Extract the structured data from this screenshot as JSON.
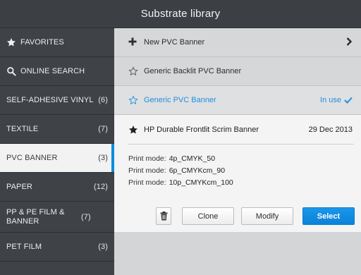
{
  "header": {
    "title": "Substrate library"
  },
  "sidebar": {
    "items": [
      {
        "label": "FAVORITES",
        "icon": "star-icon"
      },
      {
        "label": "ONLINE SEARCH",
        "icon": "search-icon"
      },
      {
        "label": "SELF-ADHESIVE VINYL",
        "count": "(6)"
      },
      {
        "label": "TEXTILE",
        "count": "(7)"
      },
      {
        "label": "PVC BANNER",
        "count": "(3)",
        "selected": true
      },
      {
        "label": "PAPER",
        "count": "(12)"
      },
      {
        "label": "PP & PE FILM & BANNER",
        "count": "(7)"
      },
      {
        "label": "PET FILM",
        "count": "(3)"
      }
    ]
  },
  "main": {
    "new_item": {
      "label": "New PVC Banner"
    },
    "items": [
      {
        "label": "Generic Backlit PVC Banner"
      },
      {
        "label": "Generic PVC Banner",
        "status": "In use"
      }
    ],
    "expanded": {
      "name": "HP Durable Frontlit Scrim Banner",
      "date": "29 Dec 2013",
      "print_modes": [
        {
          "label": "Print mode:",
          "value": "4p_CMYK_50"
        },
        {
          "label": "Print mode:",
          "value": "6p_CMYKcm_90"
        },
        {
          "label": "Print mode:",
          "value": "10p_CMYKcm_100"
        }
      ],
      "actions": {
        "clone": "Clone",
        "modify": "Modify",
        "select": "Select"
      }
    }
  },
  "colors": {
    "accent": "#0a8de0",
    "sidebar_bg": "#3f4246",
    "titlebar_bg": "#3c4045",
    "main_bg": "#d4d5d6",
    "card_bg": "#f4f4f4"
  }
}
